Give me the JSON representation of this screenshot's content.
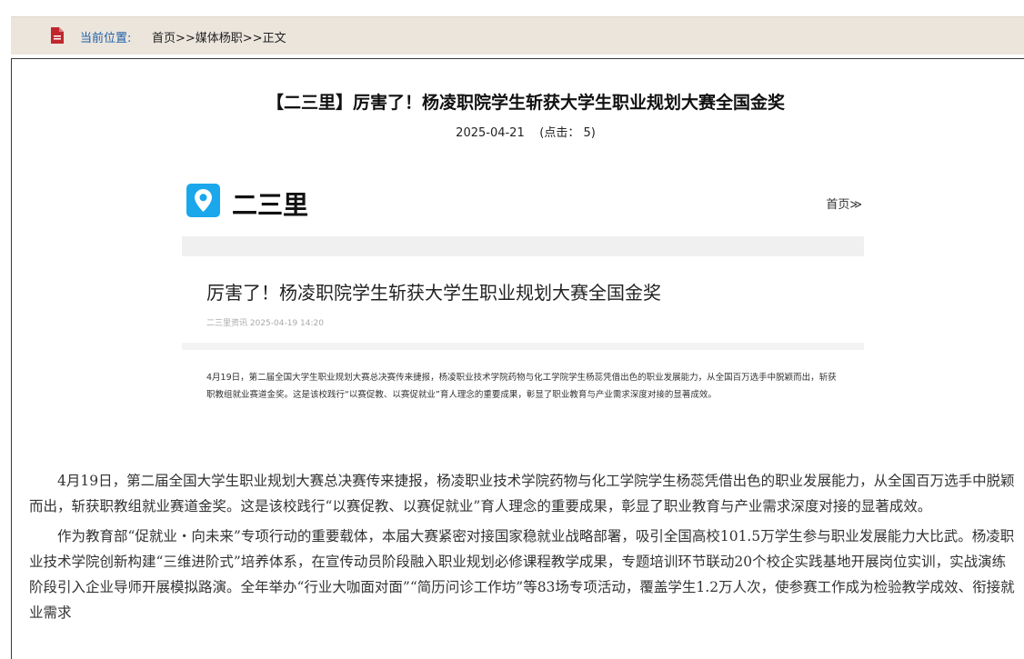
{
  "breadcrumb": {
    "label": "当前位置:",
    "path": "首页>>媒体杨职>>正文"
  },
  "article": {
    "title": "【二三里】厉害了！杨凌职院学生斩获大学生职业规划大赛全国金奖",
    "date": "2025-04-21",
    "hits": "(点击： 5)"
  },
  "embed": {
    "brand": "二三里",
    "home_link": "首页≫",
    "card_title": "厉害了！杨凌职院学生斩获大学生职业规划大赛全国金奖",
    "card_meta": "二三里资讯 2025-04-19 14:20",
    "card_body": "4月19日，第二届全国大学生职业规划大赛总决赛传来捷报，杨凌职业技术学院药物与化工学院学生杨蕊凭借出色的职业发展能力，从全国百万选手中脱颖而出，斩获职教组就业赛道金奖。这是该校践行“以赛促教、以赛促就业”育人理念的重要成果，彰显了职业教育与产业需求深度对接的显著成效。"
  },
  "body": {
    "paragraphs": [
      "4月19日，第二届全国大学生职业规划大赛总决赛传来捷报，杨凌职业技术学院药物与化工学院学生杨蕊凭借出色的职业发展能力，从全国百万选手中脱颖而出，斩获职教组就业赛道金奖。这是该校践行“以赛促教、以赛促就业”育人理念的重要成果，彰显了职业教育与产业需求深度对接的显著成效。",
      "作为教育部“促就业・向未来”专项行动的重要载体，本届大赛紧密对接国家稳就业战略部署，吸引全国高校101.5万学生参与职业发展能力大比武。杨凌职业技术学院创新构建“三维进阶式”培养体系，在宣传动员阶段融入职业规划必修课程教学成果，专题培训环节联动20个校企实践基地开展岗位实训，实战演练阶段引入企业导师开展模拟路演。全年举办“行业大咖面对面”“简历问诊工作坊”等83场专项活动，覆盖学生1.2万人次，使参赛工作成为检验教学成效、衔接就业需求"
    ]
  },
  "colors": {
    "breadcrumb_bg": "#ebe5dc",
    "link_blue": "#1f5fa8",
    "doc_icon_red": "#c0272d",
    "brand_blue": "#1aa7ec"
  }
}
